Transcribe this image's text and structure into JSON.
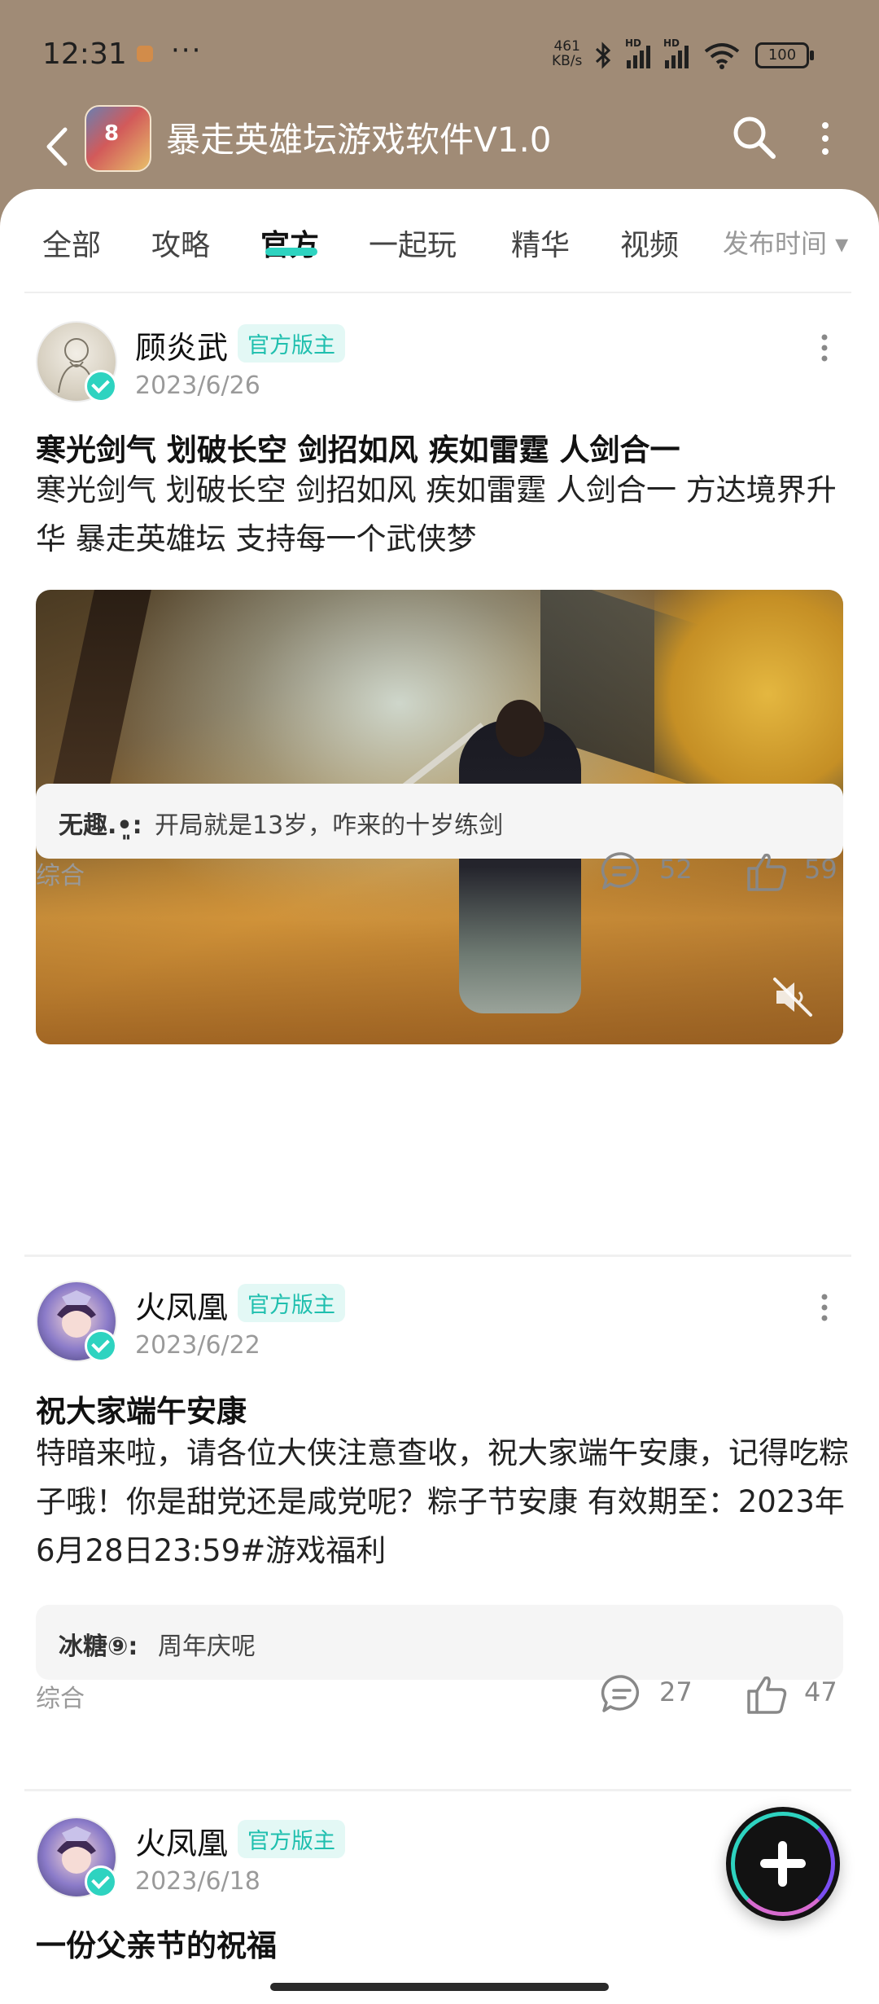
{
  "status_bar": {
    "time": "12:31",
    "more": "···",
    "net_speed_value": "461",
    "net_speed_unit": "KB/s",
    "battery": "100",
    "hd_label": "HD"
  },
  "header": {
    "title": "暴走英雄坛游戏软件V1.0",
    "game_icon_text": "8"
  },
  "tabs": [
    {
      "label": "全部"
    },
    {
      "label": "攻略"
    },
    {
      "label": "官方"
    },
    {
      "label": "一起玩"
    },
    {
      "label": "精华"
    },
    {
      "label": "视频"
    }
  ],
  "active_tab": "官方",
  "sort": {
    "label": "发布时间 ▾"
  },
  "posts": [
    {
      "author": "顾炎武",
      "badge": "官方版主",
      "date": "2023/6/26",
      "title": "寒光剑气 划破长空 剑招如风 疾如雷霆 人剑合一",
      "body": "寒光剑气 划破长空 剑招如风 疾如雷霆 人剑合一 方达境界升华 暴走英雄坛 支持每一个武侠梦",
      "comment_user": "无趣.•͈:",
      "comment_text": "开局就是13岁，咋来的十岁练剑",
      "category": "综合",
      "comments": "52",
      "likes": "59"
    },
    {
      "author": "火凤凰",
      "badge": "官方版主",
      "date": "2023/6/22",
      "title": "祝大家端午安康",
      "body": "特暗来啦，请各位大侠注意查收，祝大家端午安康，记得吃粽子哦！你是甜党还是咸党呢？粽子节安康 有效期至：2023年6月28日23:59#游戏福利",
      "comment_user": "冰糖⑨:",
      "comment_text": "周年庆呢",
      "category": "综合",
      "comments": "27",
      "likes": "47"
    },
    {
      "author": "火凤凰",
      "badge": "官方版主",
      "date": "2023/6/18",
      "title": "一份父亲节的祝福"
    }
  ],
  "colors": {
    "header_bg": "#a08b76",
    "accent": "#2ed3c0",
    "badge_bg": "#e3f8f5"
  }
}
